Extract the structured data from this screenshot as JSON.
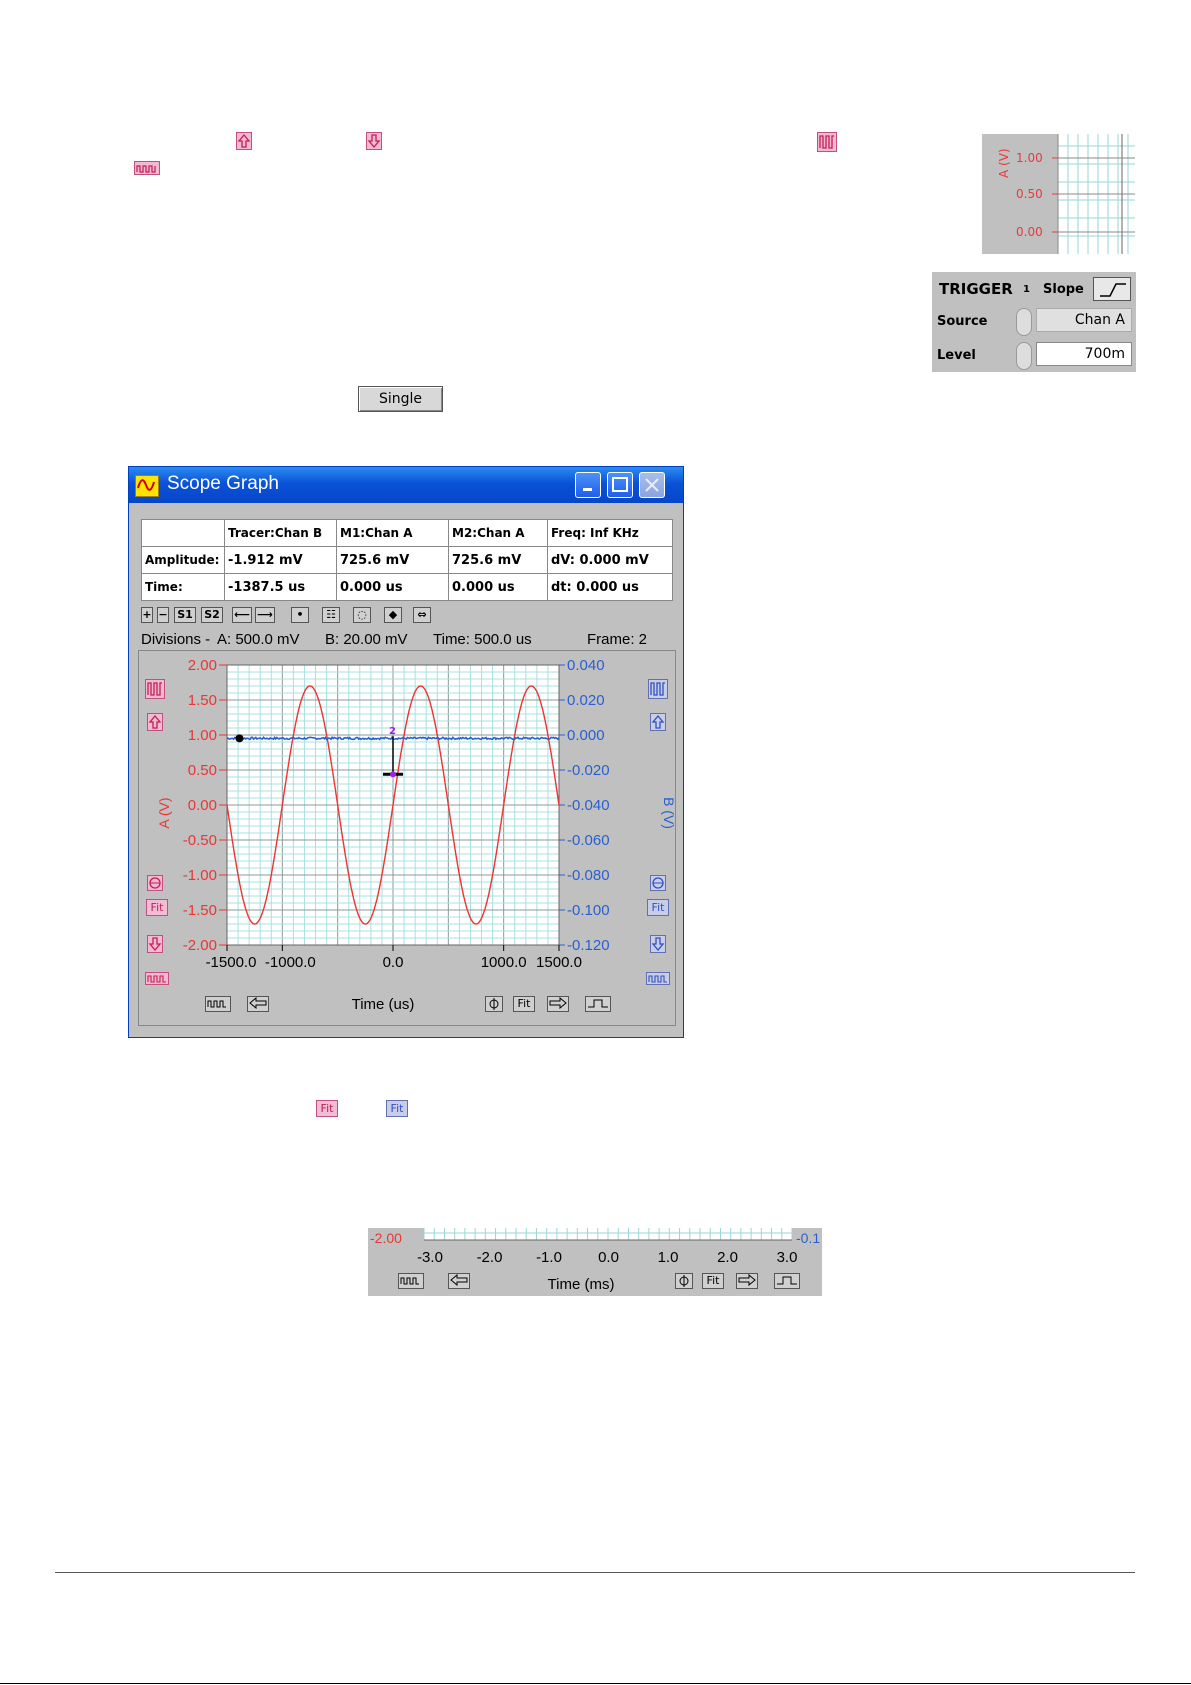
{
  "mini_chart": {
    "axis_label": "A (V)",
    "ticks": [
      "1.00",
      "0.50",
      "0.00"
    ],
    "axis_color": "#e83a3a"
  },
  "trigger": {
    "title": "TRIGGER",
    "title_index": "1",
    "slope_label": "Slope",
    "source_label": "Source",
    "source_value": "Chan A",
    "level_label": "Level",
    "level_value": "700m"
  },
  "single_button": {
    "label": "Single"
  },
  "scope_window": {
    "title": "Scope Graph",
    "table": {
      "headers": [
        "",
        "Tracer:Chan B",
        "M1:Chan A",
        "M2:Chan A",
        "Freq: Inf KHz"
      ],
      "rows": [
        [
          "Amplitude:",
          "-1.912 mV",
          "725.6 mV",
          "725.6 mV",
          "dV: 0.000 mV"
        ],
        [
          "Time:",
          "-1387.5 us",
          "0.000 us",
          "0.000 us",
          "dt:  0.000 us"
        ]
      ]
    },
    "toolbar": [
      "+",
      "−",
      "S1",
      "S2",
      "⟵",
      "⟶",
      "•",
      "☷",
      "◌",
      "◆",
      "⇔"
    ],
    "divisions": {
      "label": "Divisions -",
      "a": "A: 500.0 mV",
      "b": "B: 20.00 mV",
      "time": "Time: 500.0 us",
      "frame": "Frame: 2"
    },
    "fit_label": "Fit",
    "x_axis_title": "Time (us)"
  },
  "chart_data": {
    "type": "line",
    "xlabel": "Time (us)",
    "ylabel": "A (V)",
    "y2label": "B (V)",
    "xlim": [
      -1500,
      1500
    ],
    "ylim": [
      -2.0,
      2.0
    ],
    "y2lim": [
      -0.12,
      0.04
    ],
    "x_ticks": [
      "-1500.0",
      "-1000.0",
      "0.0",
      "1000.0",
      "1500.0"
    ],
    "x_tick_values": [
      -1500,
      -1000,
      0,
      1000,
      1500
    ],
    "y_ticks": [
      "2.00",
      "1.50",
      "1.00",
      "0.50",
      "0.00",
      "-0.50",
      "-1.00",
      "-1.50",
      "-2.00"
    ],
    "y2_ticks": [
      "0.040",
      "0.020",
      "0.000",
      "-0.020",
      "-0.040",
      "-0.060",
      "-0.080",
      "-0.100",
      "-0.120"
    ],
    "series": [
      {
        "name": "Chan A",
        "color": "#ee3333",
        "axis": "left",
        "amplitude": 1.7,
        "frequency_khz": 1.0,
        "phase_deg": 0,
        "offset": 0.0
      },
      {
        "name": "Chan B",
        "color": "#2a5fd0",
        "axis": "right",
        "value": -0.0019
      }
    ],
    "markers": {
      "m1_time": 0.0,
      "m1_value": 0.7256
    },
    "grid": true
  },
  "strip": {
    "y_left": "-2.00",
    "y_right": "-0.1",
    "x_ticks": [
      "-3.0",
      "-2.0",
      "-1.0",
      "0.0",
      "1.0",
      "2.0",
      "3.0"
    ],
    "x_title": "Time (ms)",
    "fit_label": "Fit"
  },
  "inline_fit": {
    "red": "Fit",
    "blue": "Fit"
  }
}
